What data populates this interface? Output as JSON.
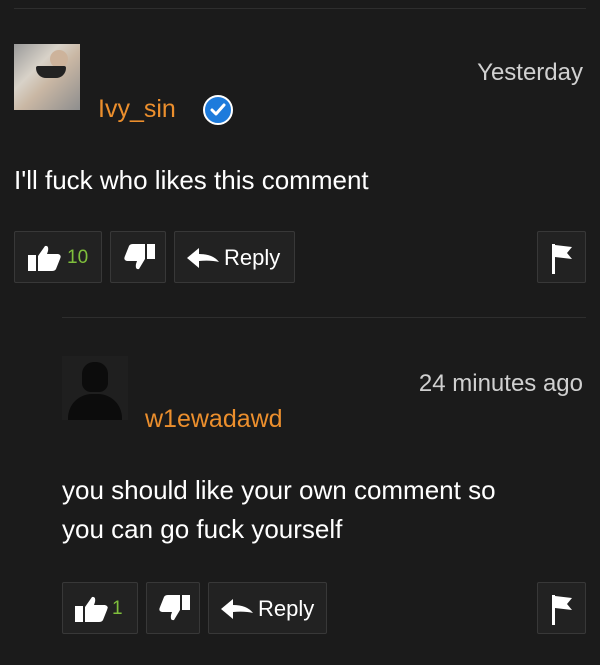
{
  "comments": [
    {
      "username": "Ivy_sin",
      "verified": true,
      "time": "Yesterday",
      "text": "I'll fuck who likes this comment",
      "likes": "10",
      "reply_label": "Reply"
    },
    {
      "username": "w1ewadawd",
      "verified": false,
      "time": "24 minutes ago",
      "text_lines": [
        "you should like your own comment so",
        "you can go fuck yourself"
      ],
      "likes": "1",
      "reply_label": "Reply"
    }
  ],
  "colors": {
    "background": "#1b1b1b",
    "username": "#ec8f2d",
    "like_count": "#7fbf3c",
    "verified_badge": "#1d7bdc"
  },
  "icons": [
    "thumbs-up-icon",
    "thumbs-down-icon",
    "reply-arrow-icon",
    "flag-icon",
    "verified-check-icon"
  ]
}
